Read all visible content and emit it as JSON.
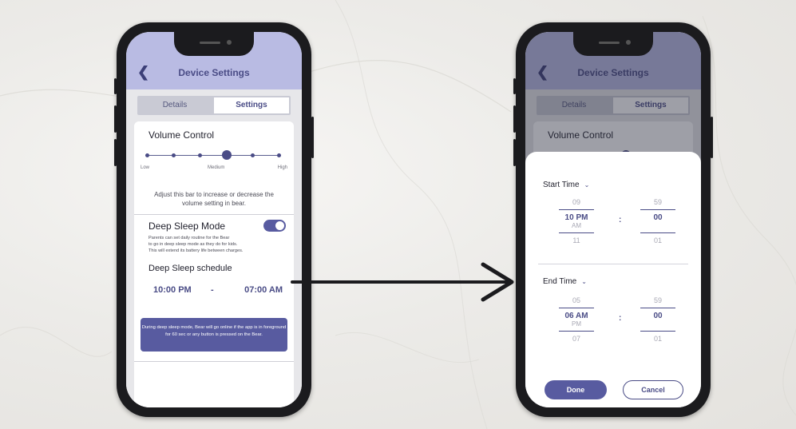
{
  "colors": {
    "accent": "#585ba0",
    "header": "#b9bbe3",
    "text_accent": "#4a4c86"
  },
  "screen1": {
    "header": {
      "back_icon": "chevron-left-icon",
      "title": "Device Settings"
    },
    "tabs": {
      "details": "Details",
      "settings": "Settings"
    },
    "volume": {
      "title": "Volume Control",
      "labels": {
        "low": "Low",
        "medium": "Medium",
        "high": "High"
      },
      "level": 0.6,
      "description": "Adjust this bar to increase or decrease the volume setting in bear."
    },
    "deep_sleep": {
      "title": "Deep Sleep Mode",
      "enabled": true,
      "description_lines": [
        "Parents can set daily routine for the Bear",
        "to go in deep sleep mode as they do for kids.",
        "This will extend its battery life between charges."
      ],
      "schedule_title": "Deep Sleep schedule",
      "start": "10:00 PM",
      "separator": "-",
      "end": "07:00 AM",
      "note": "During deep sleep mode, Bear will go online if the app is in foreground for 60 sec or any button is pressed on the Bear."
    }
  },
  "screen2": {
    "header": {
      "back_icon": "chevron-left-icon",
      "title": "Device Settings"
    },
    "tabs": {
      "details": "Details",
      "settings": "Settings"
    },
    "volume_title": "Volume Control",
    "start_picker": {
      "title": "Start Time",
      "hour_prev": "09",
      "hour_sel": "10 PM",
      "ampm_alt": "AM",
      "hour_next": "11",
      "min_prev": "59",
      "min_sel": "00",
      "min_next": "01",
      "colon": ":"
    },
    "end_picker": {
      "title": "End Time",
      "hour_prev": "05",
      "hour_sel": "06 AM",
      "ampm_alt": "PM",
      "hour_next": "07",
      "min_prev": "59",
      "min_sel": "00",
      "min_next": "01",
      "colon": ":"
    },
    "buttons": {
      "done": "Done",
      "cancel": "Cancel"
    }
  }
}
